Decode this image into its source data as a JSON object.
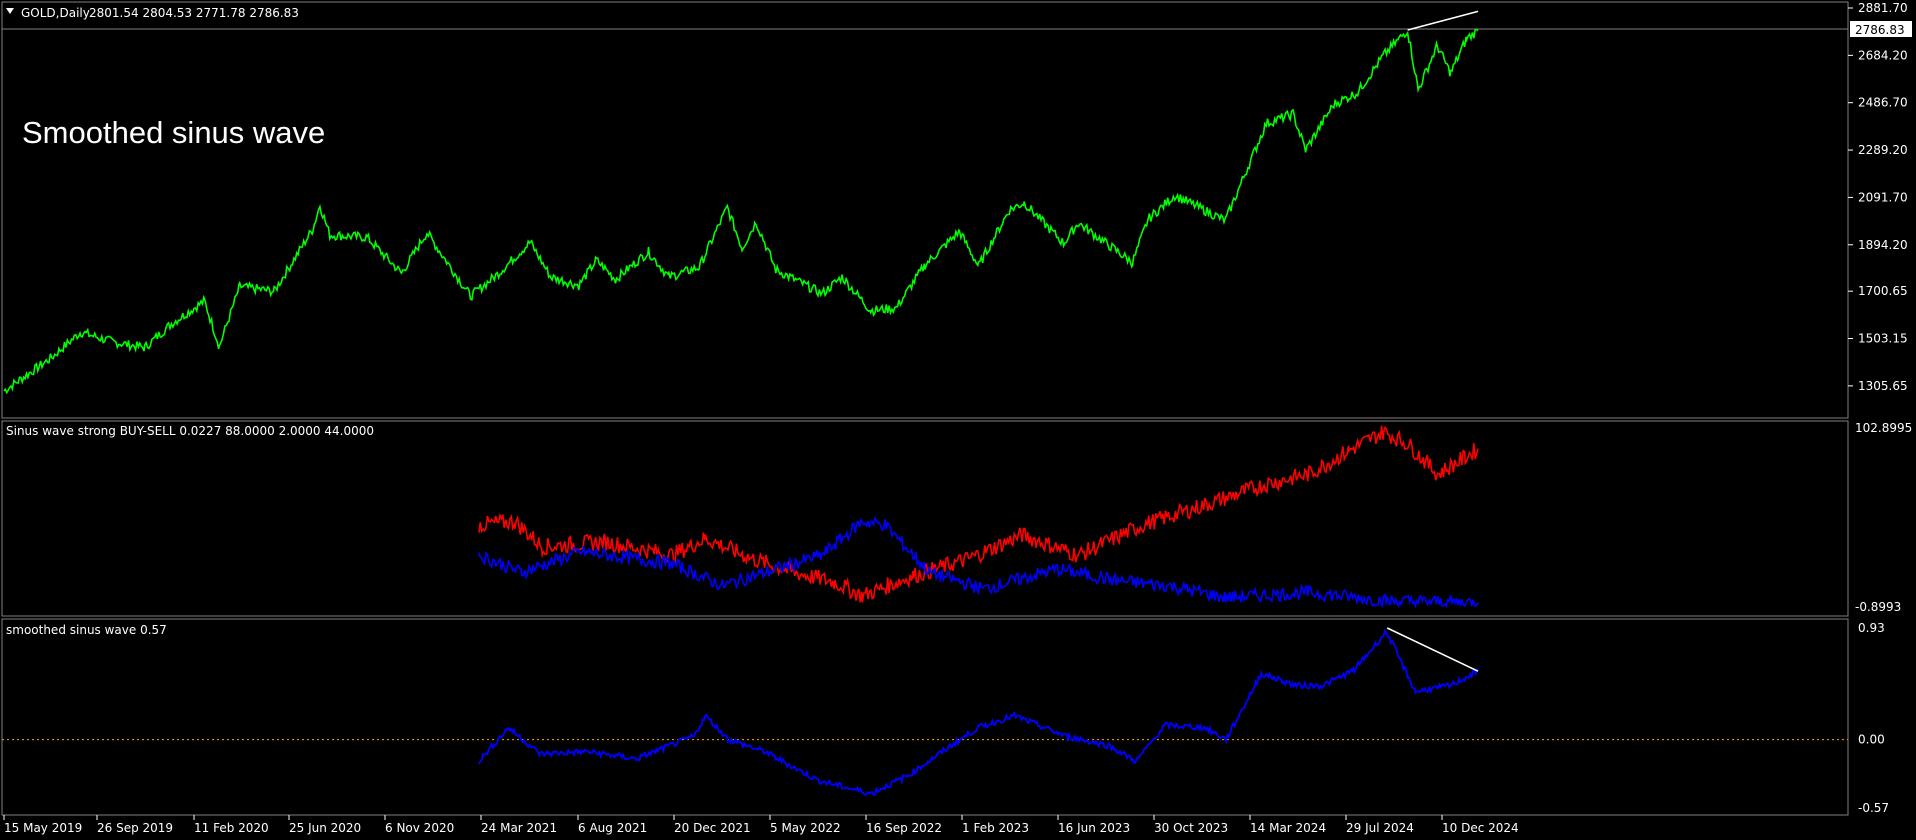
{
  "header": {
    "symbol_label": "GOLD,Daily",
    "ohlc": "2801.54 2804.53 2771.78 2786.83",
    "overlay_title": "Smoothed sinus wave"
  },
  "panes": {
    "indicator1_label": "Sinus wave strong BUY-SELL 0.0227 88.0000 2.0000 44.0000",
    "indicator2_label": "smoothed sinus wave 0.57"
  },
  "colors": {
    "price": "#00ff00",
    "sell_line": "#ff0000",
    "buy_line": "#0000ff",
    "wave": "#0000ff",
    "trendline": "#ffffff",
    "zero_line": "#ffa500",
    "grid_sep": "#808080"
  },
  "chart_data": [
    {
      "type": "line",
      "title": "GOLD,Daily",
      "ohlc_last": {
        "open": 2801.54,
        "high": 2804.53,
        "low": 2771.78,
        "close": 2786.83
      },
      "ylim": [
        1180,
        2881.7
      ],
      "y_ticks": [
        "2881.70",
        "2684.20",
        "2486.70",
        "2289.20",
        "2091.70",
        "1894.20",
        "1700.65",
        "1503.15",
        "1305.65"
      ],
      "current_price": "2786.83",
      "x_ticks": [
        "15 May 2019",
        "26 Sep 2019",
        "11 Feb 2020",
        "25 Jun 2020",
        "6 Nov 2020",
        "24 Mar 2021",
        "6 Aug 2021",
        "20 Dec 2021",
        "5 May 2022",
        "16 Sep 2022",
        "1 Feb 2023",
        "16 Jun 2023",
        "30 Oct 2023",
        "14 Mar 2024",
        "29 Jul 2024",
        "10 Dec 2024"
      ],
      "series": [
        {
          "values": [
            [
              "2019-05-15",
              1285
            ],
            [
              "2019-07-20",
              1420
            ],
            [
              "2019-09-01",
              1530
            ],
            [
              "2019-10-15",
              1490
            ],
            [
              "2019-12-01",
              1465
            ],
            [
              "2020-01-08",
              1565
            ],
            [
              "2020-02-24",
              1660
            ],
            [
              "2020-03-16",
              1470
            ],
            [
              "2020-04-14",
              1720
            ],
            [
              "2020-06-02",
              1700
            ],
            [
              "2020-07-27",
              1960
            ],
            [
              "2020-08-06",
              2060
            ],
            [
              "2020-08-20",
              1935
            ],
            [
              "2020-10-12",
              1925
            ],
            [
              "2020-11-30",
              1775
            ],
            [
              "2021-01-05",
              1945
            ],
            [
              "2021-03-08",
              1680
            ],
            [
              "2021-04-15",
              1770
            ],
            [
              "2021-06-01",
              1905
            ],
            [
              "2021-06-30",
              1760
            ],
            [
              "2021-08-09",
              1725
            ],
            [
              "2021-09-03",
              1830
            ],
            [
              "2021-09-30",
              1750
            ],
            [
              "2021-11-16",
              1865
            ],
            [
              "2021-12-15",
              1760
            ],
            [
              "2022-01-27",
              1800
            ],
            [
              "2022-03-08",
              2050
            ],
            [
              "2022-03-29",
              1880
            ],
            [
              "2022-04-18",
              1990
            ],
            [
              "2022-05-16",
              1790
            ],
            [
              "2022-07-21",
              1690
            ],
            [
              "2022-08-18",
              1760
            ],
            [
              "2022-09-28",
              1620
            ],
            [
              "2022-11-03",
              1630
            ],
            [
              "2022-12-14",
              1810
            ],
            [
              "2023-02-01",
              1950
            ],
            [
              "2023-02-28",
              1805
            ],
            [
              "2023-04-13",
              2040
            ],
            [
              "2023-05-04",
              2070
            ],
            [
              "2023-06-29",
              1900
            ],
            [
              "2023-07-20",
              1985
            ],
            [
              "2023-10-05",
              1820
            ],
            [
              "2023-10-27",
              2000
            ],
            [
              "2023-12-04",
              2100
            ],
            [
              "2024-02-14",
              1995
            ],
            [
              "2024-04-12",
              2400
            ],
            [
              "2024-05-20",
              2440
            ],
            [
              "2024-06-07",
              2290
            ],
            [
              "2024-07-17",
              2480
            ],
            [
              "2024-08-20",
              2530
            ],
            [
              "2024-09-26",
              2685
            ],
            [
              "2024-10-30",
              2790
            ],
            [
              "2024-11-14",
              2540
            ],
            [
              "2024-12-11",
              2725
            ],
            [
              "2024-12-30",
              2610
            ],
            [
              "2025-01-22",
              2755
            ],
            [
              "2025-02-07",
              2786.83
            ]
          ]
        }
      ],
      "annotations": [
        {
          "type": "trendline",
          "from": [
            "2024-10-30",
            2790
          ],
          "to": [
            "2025-02-07",
            2880
          ]
        }
      ]
    },
    {
      "type": "line",
      "title": "Sinus wave strong BUY-SELL 0.0227 88.0000 2.0000 44.0000",
      "ylim": [
        0,
        102.8995
      ],
      "y_ticks": [
        "102.8995",
        "-0.8993"
      ],
      "series": [
        {
          "color": "red",
          "values": [
            [
              "2021-03-20",
              48
            ],
            [
              "2021-05-10",
              50
            ],
            [
              "2021-06-18",
              35
            ],
            [
              "2021-09-15",
              38
            ],
            [
              "2021-12-20",
              30
            ],
            [
              "2022-02-05",
              40
            ],
            [
              "2022-04-12",
              28
            ],
            [
              "2022-06-10",
              20
            ],
            [
              "2022-08-08",
              14
            ],
            [
              "2022-09-16",
              6
            ],
            [
              "2022-11-28",
              18
            ],
            [
              "2023-02-15",
              28
            ],
            [
              "2023-05-01",
              42
            ],
            [
              "2023-07-20",
              30
            ],
            [
              "2023-10-20",
              48
            ],
            [
              "2024-02-01",
              62
            ],
            [
              "2024-04-11",
              72
            ],
            [
              "2024-06-12",
              78
            ],
            [
              "2024-08-08",
              92
            ],
            [
              "2024-09-26",
              103
            ],
            [
              "2024-10-30",
              96
            ],
            [
              "2024-12-12",
              78
            ],
            [
              "2025-01-20",
              88
            ],
            [
              "2025-02-07",
              93
            ]
          ]
        },
        {
          "color": "blue",
          "values": [
            [
              "2021-03-20",
              30
            ],
            [
              "2021-05-20",
              20
            ],
            [
              "2021-08-12",
              32
            ],
            [
              "2021-12-20",
              25
            ],
            [
              "2022-03-01",
              12
            ],
            [
              "2022-07-20",
              30
            ],
            [
              "2022-09-16",
              50
            ],
            [
              "2022-10-18",
              48
            ],
            [
              "2022-12-20",
              20
            ],
            [
              "2023-03-08",
              10
            ],
            [
              "2023-06-20",
              22
            ],
            [
              "2023-09-12",
              15
            ],
            [
              "2023-11-25",
              12
            ],
            [
              "2024-02-14",
              5
            ],
            [
              "2024-06-10",
              8
            ],
            [
              "2024-10-01",
              3
            ],
            [
              "2025-02-07",
              2
            ]
          ]
        }
      ]
    },
    {
      "type": "line",
      "title": "smoothed sinus wave 0.57",
      "ylim": [
        -0.57,
        0.93
      ],
      "y_ticks": [
        "0.93",
        "0.00",
        "-0.57"
      ],
      "zero_line": 0,
      "series": [
        {
          "values": [
            [
              "2021-03-20",
              -0.18
            ],
            [
              "2021-05-01",
              0.1
            ],
            [
              "2021-06-15",
              -0.12
            ],
            [
              "2021-08-20",
              -0.1
            ],
            [
              "2021-10-30",
              -0.16
            ],
            [
              "2022-01-20",
              0.03
            ],
            [
              "2022-02-05",
              0.2
            ],
            [
              "2022-03-10",
              0.0
            ],
            [
              "2022-04-30",
              -0.1
            ],
            [
              "2022-07-15",
              -0.34
            ],
            [
              "2022-09-28",
              -0.45
            ],
            [
              "2022-11-20",
              -0.3
            ],
            [
              "2023-01-20",
              -0.05
            ],
            [
              "2023-02-28",
              0.1
            ],
            [
              "2023-04-20",
              0.2
            ],
            [
              "2023-07-01",
              0.03
            ],
            [
              "2023-09-01",
              -0.05
            ],
            [
              "2023-10-10",
              -0.18
            ],
            [
              "2023-11-20",
              0.12
            ],
            [
              "2024-01-15",
              0.1
            ],
            [
              "2024-02-15",
              0.0
            ],
            [
              "2024-04-05",
              0.55
            ],
            [
              "2024-05-25",
              0.45
            ],
            [
              "2024-07-01",
              0.45
            ],
            [
              "2024-08-15",
              0.58
            ],
            [
              "2024-09-30",
              0.9
            ],
            [
              "2024-11-10",
              0.4
            ],
            [
              "2024-12-30",
              0.45
            ],
            [
              "2025-02-07",
              0.57
            ]
          ]
        }
      ],
      "annotations": [
        {
          "type": "trendline",
          "from": [
            "2024-10-01",
            0.93
          ],
          "to": [
            "2025-02-07",
            0.57
          ]
        }
      ]
    }
  ]
}
